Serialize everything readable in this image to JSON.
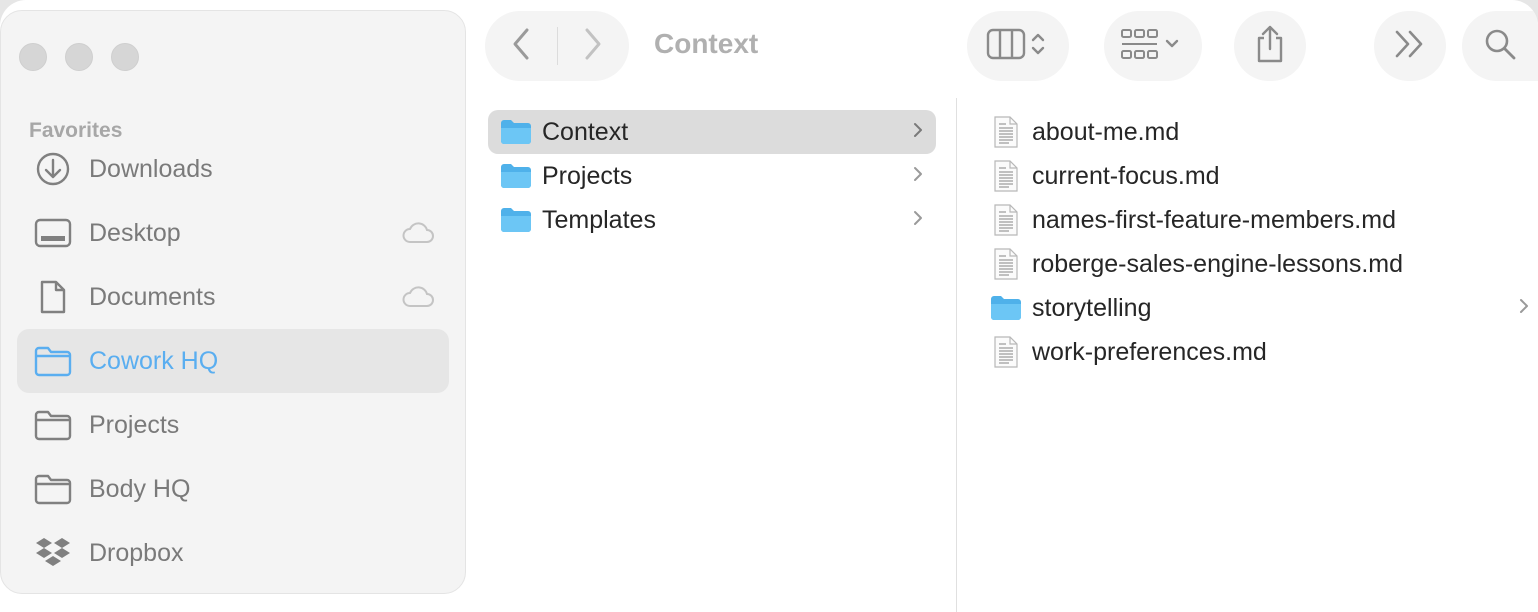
{
  "window": {
    "title": "Context"
  },
  "sidebar": {
    "section_label": "Favorites",
    "items": [
      {
        "label": "Downloads",
        "icon": "download-icon",
        "cloud": false,
        "selected": false
      },
      {
        "label": "Desktop",
        "icon": "desktop-icon",
        "cloud": true,
        "selected": false
      },
      {
        "label": "Documents",
        "icon": "document-icon",
        "cloud": true,
        "selected": false
      },
      {
        "label": "Cowork HQ",
        "icon": "folder-icon",
        "cloud": false,
        "selected": true
      },
      {
        "label": "Projects",
        "icon": "folder-icon",
        "cloud": false,
        "selected": false
      },
      {
        "label": "Body HQ",
        "icon": "folder-icon",
        "cloud": false,
        "selected": false
      },
      {
        "label": "Dropbox",
        "icon": "dropbox-icon",
        "cloud": false,
        "selected": false
      }
    ]
  },
  "toolbar": {
    "back_icon": "chevron-left-icon",
    "forward_icon": "chevron-right-icon",
    "view_icon": "columns-view-icon",
    "group_icon": "grid-group-icon",
    "share_icon": "share-icon",
    "more_icon": "double-chevron-icon",
    "search_icon": "search-icon"
  },
  "column1": {
    "items": [
      {
        "label": "Context",
        "selected": true
      },
      {
        "label": "Projects",
        "selected": false
      },
      {
        "label": "Templates",
        "selected": false
      }
    ]
  },
  "column2": {
    "items": [
      {
        "label": "about-me.md",
        "type": "file"
      },
      {
        "label": "current-focus.md",
        "type": "file"
      },
      {
        "label": "names-first-feature-members.md",
        "type": "file"
      },
      {
        "label": "roberge-sales-engine-lessons.md",
        "type": "file"
      },
      {
        "label": "storytelling",
        "type": "folder"
      },
      {
        "label": "work-preferences.md",
        "type": "file"
      }
    ]
  },
  "colors": {
    "accent": "#5aaef0",
    "folder_blue": "#5cbcf0",
    "sidebar_text": "#7a7a7a"
  }
}
